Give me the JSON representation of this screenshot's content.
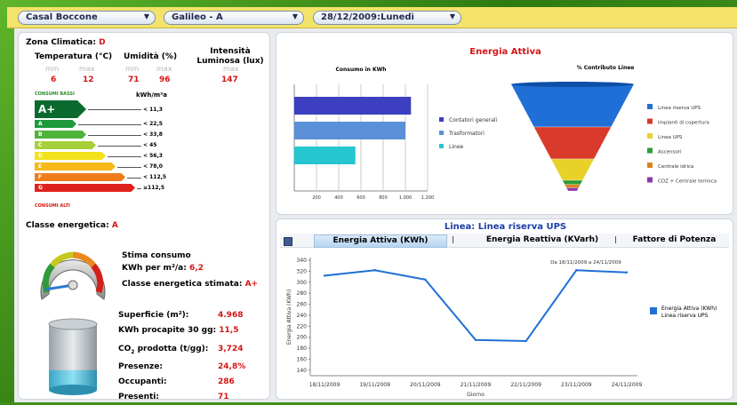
{
  "toolbar": {
    "site": "Casal Boccone",
    "building": "Galileo - A",
    "date": "28/12/2009:Lunedì"
  },
  "climate": {
    "zone_label": "Zona Climatica:",
    "zone_value": "D",
    "temp_label": "Temperatura (°C)",
    "hum_label": "Umidità (%)",
    "lux_label_1": "Intensità",
    "lux_label_2": "Luminosa (lux)",
    "min": "min",
    "max": "max",
    "temp_min": "6",
    "temp_max": "12",
    "hum_min": "71",
    "hum_max": "96",
    "lux_max": "147"
  },
  "energy_label": {
    "top_caption": "CONSUMI BASSI",
    "bottom_caption": "CONSUMI ALTI",
    "unit": "kWh/m²a",
    "selected_class": "A+",
    "classes": [
      {
        "letter": "A+",
        "threshold": "< 11,3",
        "color": "#0b6b2e"
      },
      {
        "letter": "A",
        "threshold": "< 22,5",
        "color": "#1e9a3c"
      },
      {
        "letter": "B",
        "threshold": "< 33,8",
        "color": "#4fb33c"
      },
      {
        "letter": "C",
        "threshold": "< 45",
        "color": "#a6cf3a"
      },
      {
        "letter": "D",
        "threshold": "< 56,3",
        "color": "#f2e21b"
      },
      {
        "letter": "E",
        "threshold": "< 78,0",
        "color": "#f6b81a"
      },
      {
        "letter": "F",
        "threshold": "< 112,5",
        "color": "#ef7d1e"
      },
      {
        "letter": "G",
        "threshold": "≥112,5",
        "color": "#e0221c"
      }
    ]
  },
  "summary": {
    "class_label": "Classe energetica:",
    "class_value": "A",
    "estimate_l1": "Stima consumo",
    "estimate_l2": "KWh per m²/a:",
    "estimate_value": "6,2",
    "est_class_label": "Classe energetica stimata:",
    "est_class_value": "A+",
    "surface_label": "Superficie (m²):",
    "surface_value": "4.968",
    "kwh_label": "KWh procapite 30 gg:",
    "kwh_value": "11,5",
    "co2_label_pre": "CO",
    "co2_label_sub": "2",
    "co2_label_post": "prodotta (t/gg):",
    "co2_value": "3,724",
    "presence_label": "Presenze:",
    "presence_value": "24,8%",
    "occupants_label": "Occupanti:",
    "occupants_value": "286",
    "present_label": "Presenti:",
    "present_value": "71",
    "gauge_level": 0.15,
    "cylinder_level": 0.3
  },
  "attiva": {
    "title": "Energia Attiva",
    "bar_title": "Consumo in KWh",
    "funnel_title": "% Contributo Linee"
  },
  "line_panel": {
    "title": "Linea: Linea riserva UPS",
    "tabs": [
      "Energia Attiva (KWh)",
      "Energia Reattiva (KVarh)",
      "Fattore di Potenza"
    ],
    "annotation": "Da 18/11/2009 a 24/11/2009",
    "legend_l1": "Energia Attiva (KWh)",
    "legend_l2": "Linea riserva UPS"
  },
  "chart_data": [
    {
      "type": "bar",
      "title": "Consumo in KWh",
      "categories": [
        "Contatori generali",
        "Trasformatori",
        "Linee"
      ],
      "values": [
        1050,
        1000,
        550
      ],
      "colors": [
        "#3b3fc0",
        "#5b8fd8",
        "#25c6cf"
      ],
      "xlim": [
        0,
        1200
      ],
      "tick_labels": [
        "200",
        "400",
        "600",
        "800",
        "1.000",
        "1.200"
      ]
    },
    {
      "type": "funnel",
      "title": "% Contributo Linee",
      "labels": [
        "Linea riserva UPS",
        "Impianti di copertura",
        "Linea UPS",
        "Ascensori",
        "Centrale idrica",
        "CDZ + Centrale termica"
      ],
      "values": [
        40,
        30,
        20,
        4,
        3,
        3
      ],
      "colors": [
        "#1f6fd6",
        "#d93a2b",
        "#e8d22a",
        "#2f9c3a",
        "#e0821e",
        "#8a3aa8"
      ]
    },
    {
      "type": "line",
      "x": [
        "18/11/2009",
        "19/11/2009",
        "20/11/2009",
        "21/11/2009",
        "22/11/2009",
        "23/11/2009",
        "24/11/2009"
      ],
      "series": [
        {
          "name": "Energia Attiva (KWh) Linea riserva UPS",
          "values": [
            312,
            322,
            305,
            195,
            193,
            322,
            318
          ],
          "color": "#1f6fd6"
        }
      ],
      "ylim": [
        130,
        345
      ],
      "yticks": [
        140,
        160,
        180,
        200,
        220,
        240,
        260,
        280,
        300,
        320,
        340
      ],
      "xlabel": "Giorno",
      "ylabel": "Energia Attiva (KWh)"
    }
  ]
}
